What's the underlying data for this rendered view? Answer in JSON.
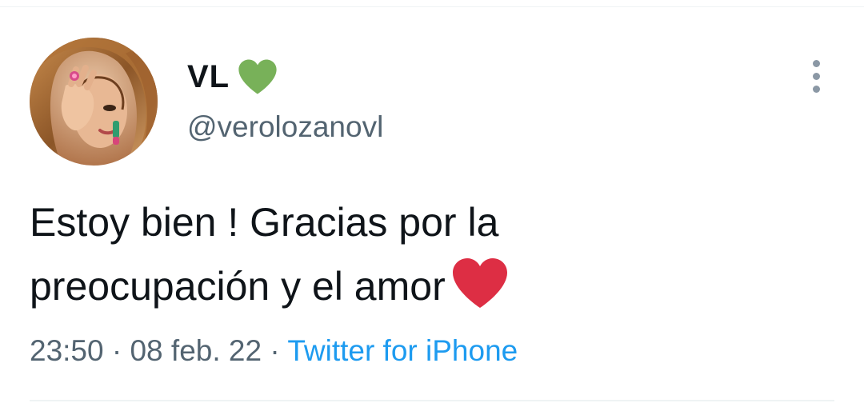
{
  "tweet": {
    "author": {
      "display_name": "VL",
      "name_emoji": "green-heart-icon",
      "handle": "@verolozanovl",
      "avatar": "profile-photo"
    },
    "text_line1": "Estoy bien ! Gracias por la",
    "text_line2": "preocupación y el amor",
    "text_emoji": "red-heart-icon",
    "time": "23:50",
    "separator": "·",
    "date": "08 feb. 22",
    "source": "Twitter for iPhone",
    "menu_icon": "more-vertical-icon"
  },
  "colors": {
    "text_primary": "#0f1419",
    "text_secondary": "#536471",
    "link": "#1d9bf0",
    "green_heart": "#78b159",
    "red_heart": "#dd2e44",
    "divider": "#eff3f4"
  }
}
